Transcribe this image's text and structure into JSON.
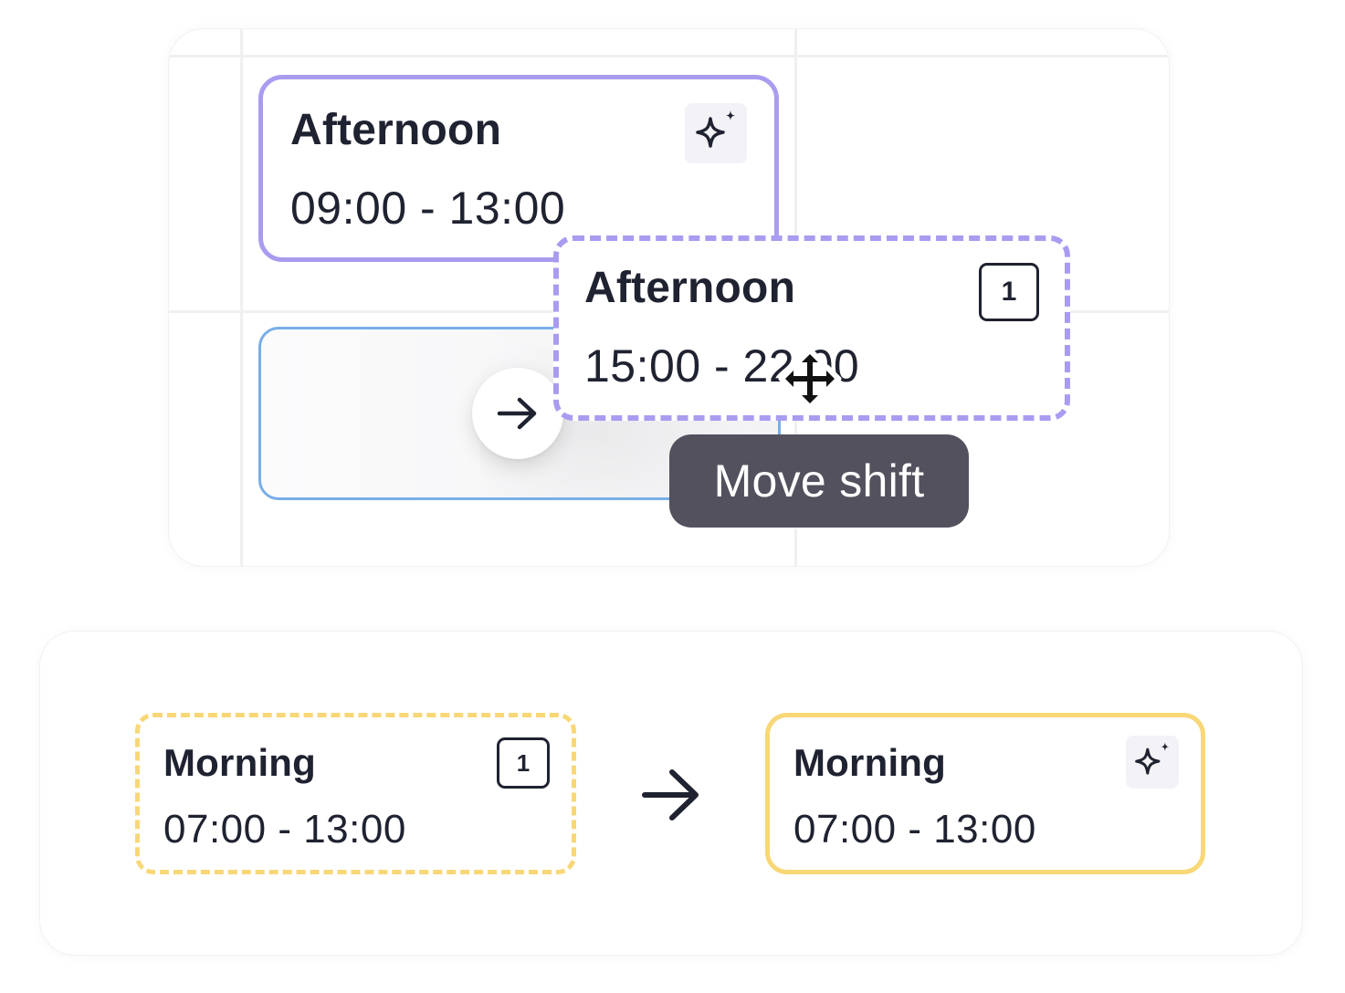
{
  "calendar": {
    "scheduled_shift": {
      "title": "Afternoon",
      "time_range": "09:00 - 13:00",
      "icon": "sparkle-icon",
      "border_color": "#a99cf0"
    },
    "empty_slot": {
      "action_icon": "arrow-right-icon",
      "border_color": "#79aee8"
    },
    "dragged_shift": {
      "title": "Afternoon",
      "time_range": "15:00 - 22:00",
      "count": "1",
      "cursor_icon": "move-cursor-icon",
      "border_color": "#a99cf0"
    },
    "tooltip": "Move shift"
  },
  "transition": {
    "before": {
      "title": "Morning",
      "time_range": "07:00 - 13:00",
      "count": "1",
      "border_color": "#f8d777"
    },
    "arrow_icon": "arrow-right-icon",
    "after": {
      "title": "Morning",
      "time_range": "07:00 - 13:00",
      "icon": "sparkle-icon",
      "border_color": "#f8d777"
    }
  }
}
